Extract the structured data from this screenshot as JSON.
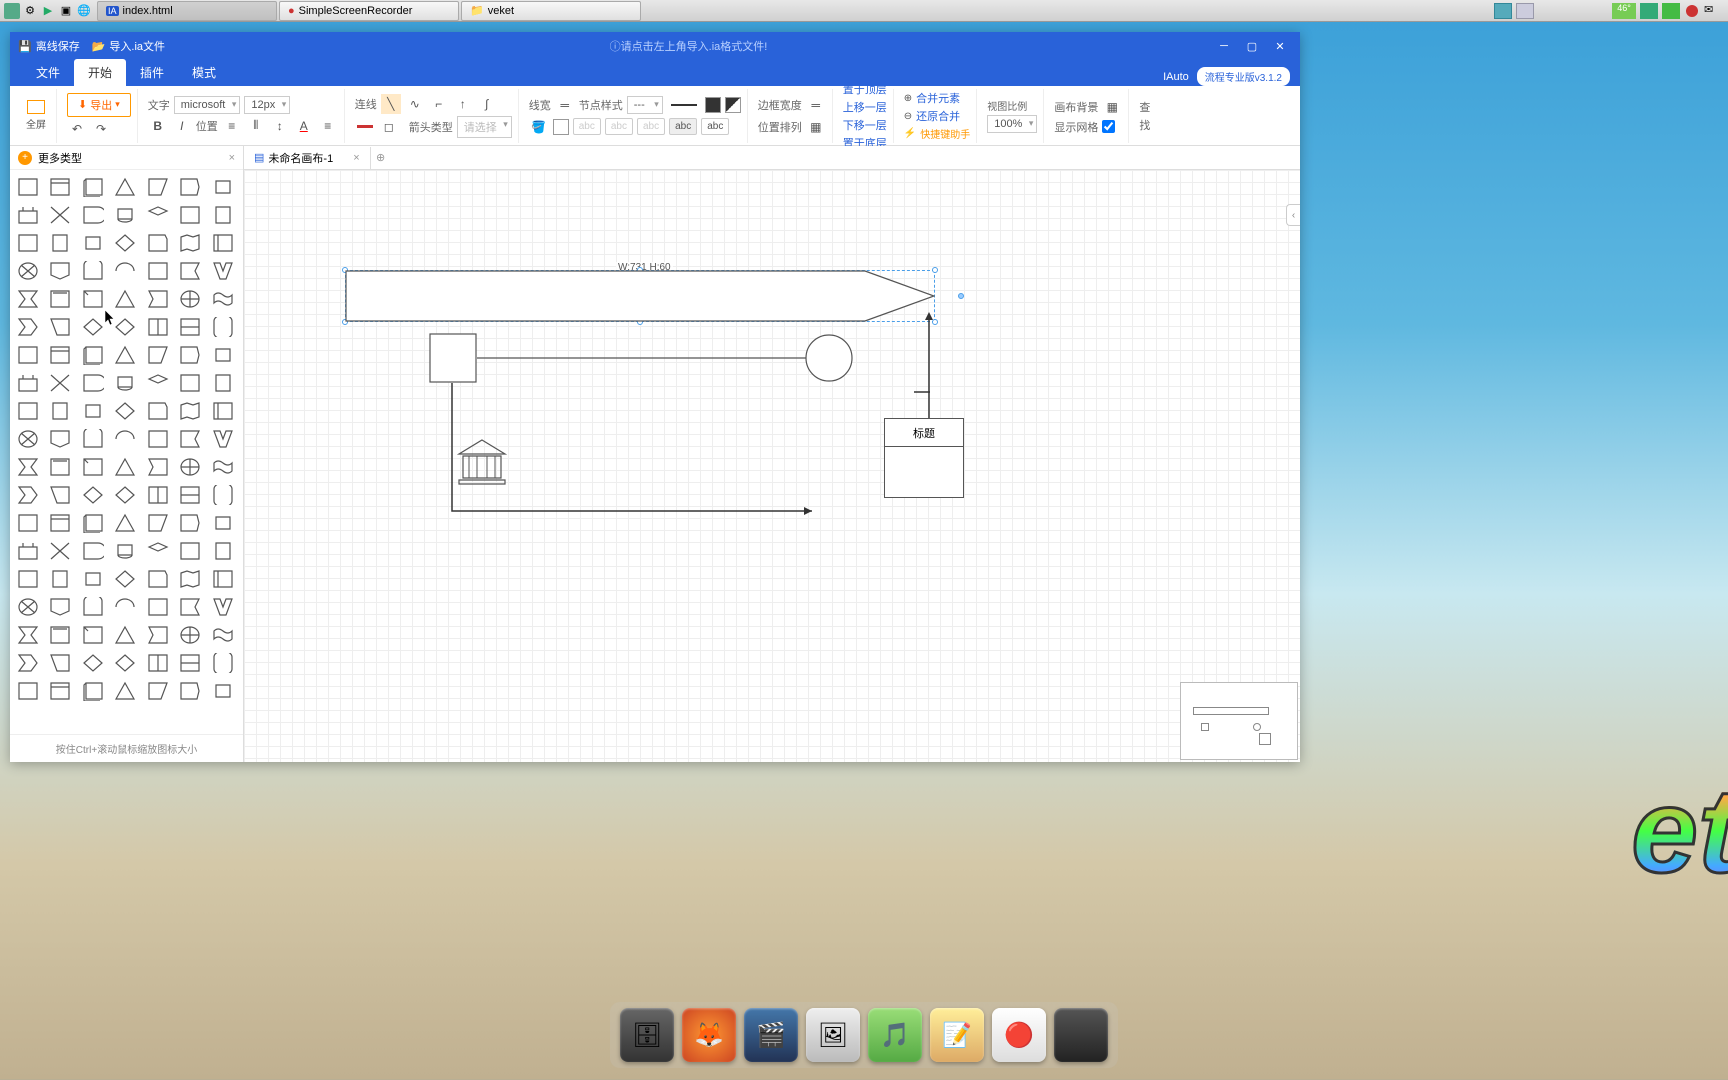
{
  "os": {
    "tasks": [
      {
        "icon": "IA",
        "label": "index.html"
      },
      {
        "icon": "●",
        "label": "SimpleScreenRecorder"
      },
      {
        "icon": "📁",
        "label": "veket"
      }
    ],
    "temp": "46°"
  },
  "titlebar": {
    "offline_save": "离线保存",
    "import_ia": "导入.ia文件",
    "center_hint": "请点击左上角导入.ia格式文件!"
  },
  "menu": {
    "tabs": [
      "文件",
      "开始",
      "插件",
      "模式"
    ],
    "active": 1,
    "brand": "IAuto",
    "version": "流程专业版v3.1.2"
  },
  "ribbon": {
    "fullscreen": "全屏",
    "export": "导出",
    "text_label": "文字",
    "font": "microsoft",
    "font_size": "12px",
    "bold": "B",
    "italic": "I",
    "pos": "位置",
    "line_label": "连线",
    "line_width": "线宽",
    "node_style": "节点样式",
    "dash": "---",
    "border_width": "边框宽度",
    "arrow_type": "箭头类型",
    "arrow_placeholder": "请选择",
    "arrange": {
      "top": "置于顶层",
      "up": "上移一层",
      "down": "下移一层",
      "bottom": "置于底层",
      "label": "位置排列"
    },
    "merge": "合并元素",
    "restore": "还原合并",
    "shortcut": "快捷键助手",
    "view_ratio": "视图比例",
    "zoom": "100%",
    "bg": "画布背景",
    "grid": "显示网格",
    "search": "查",
    "find": "找"
  },
  "shape_panel": {
    "more": "更多类型",
    "footer_hint": "按住Ctrl+滚动鼠标缩放图标大小"
  },
  "canvas": {
    "tab_name": "未命名画布-1",
    "sel_dim": "W:731 H:60",
    "title_shape_text": "标题"
  }
}
